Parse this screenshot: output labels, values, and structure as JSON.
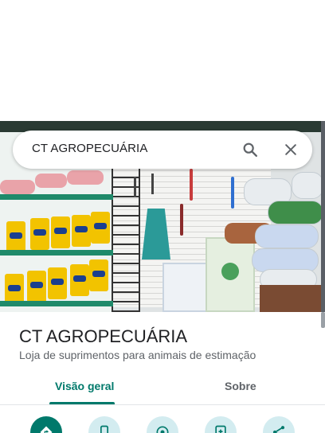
{
  "search": {
    "query": "CT AGROPECUÁRIA",
    "search_icon": "search-icon",
    "close_icon": "close-icon"
  },
  "place": {
    "name": "CT AGROPECUÁRIA",
    "category": "Loja de suprimentos para animais de estimação"
  },
  "tabs": [
    {
      "label": "Visão geral",
      "selected": true
    },
    {
      "label": "Sobre",
      "selected": false
    }
  ],
  "actions": [
    {
      "icon": "directions-icon",
      "primary": true
    },
    {
      "icon": "phone-icon",
      "primary": false
    },
    {
      "icon": "location-icon",
      "primary": false
    },
    {
      "icon": "save-icon",
      "primary": false
    },
    {
      "icon": "share-icon",
      "primary": false
    }
  ],
  "colors": {
    "accent": "#00796b",
    "action_bg": "#d3ecf0",
    "text_primary": "#202124",
    "text_secondary": "#5f6368"
  }
}
